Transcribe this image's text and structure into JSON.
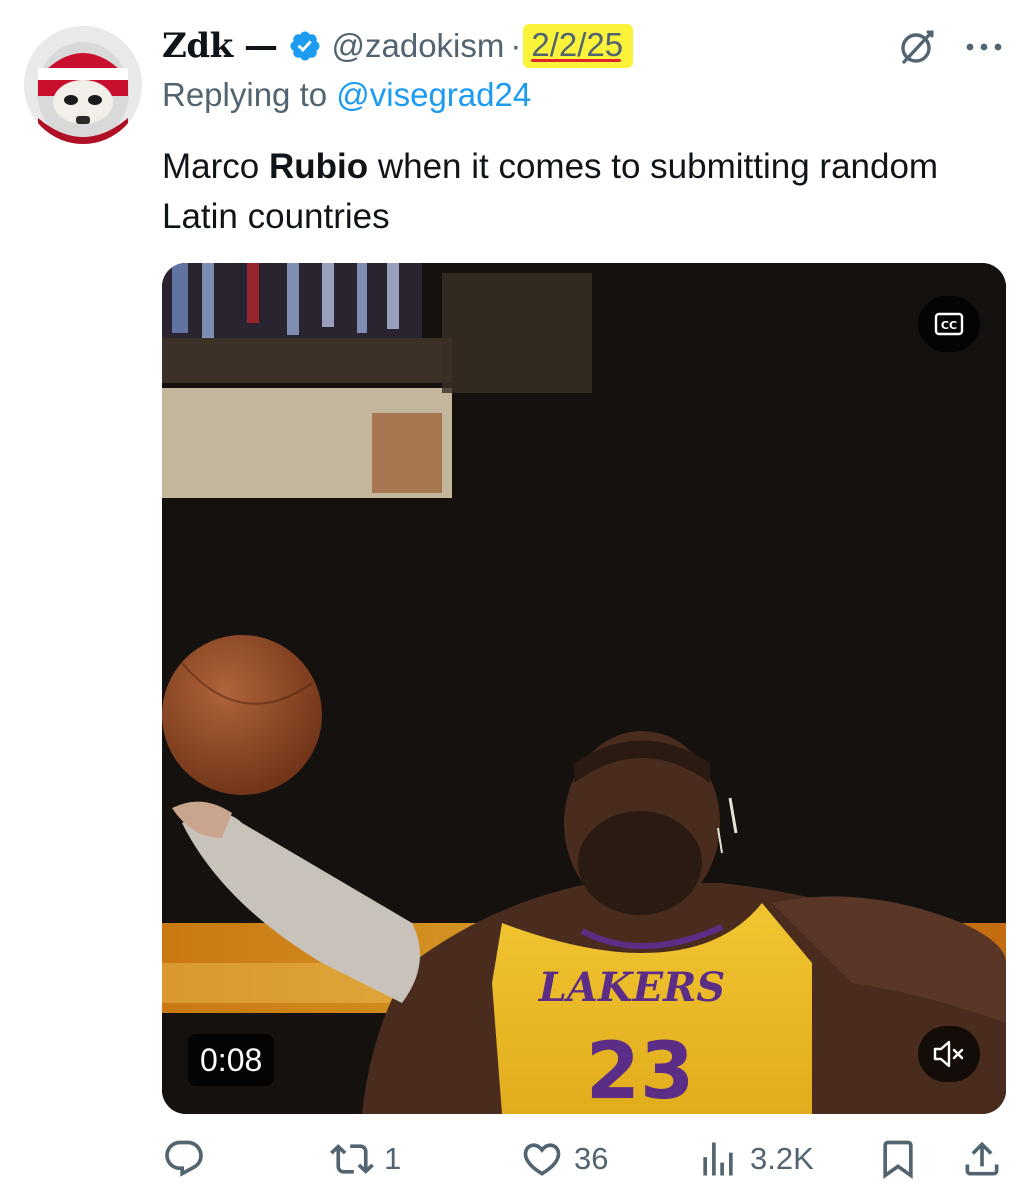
{
  "tweet": {
    "display_name": "Zdk —",
    "handle": "@zadokism",
    "separator": "·",
    "date": "2/2/25",
    "replying_prefix": "Replying to ",
    "replying_to": "@visegrad24",
    "text_before": "Marco ",
    "text_bold": "Rubio",
    "text_after": " when it comes to submitting random Latin countries"
  },
  "media": {
    "duration": "0:08",
    "cc_label": "CC",
    "jersey_text": "LAKERS",
    "jersey_number": "23"
  },
  "actions": {
    "replies": "",
    "reposts": "1",
    "likes": "36",
    "views": "3.2K"
  },
  "icons": {
    "verified": "verified-badge-icon",
    "grok": "grok-icon",
    "more": "more-icon",
    "reply": "reply-icon",
    "repost": "repost-icon",
    "like": "heart-icon",
    "views": "views-icon",
    "bookmark": "bookmark-icon",
    "share": "share-icon"
  },
  "colors": {
    "accent": "#1d9bf0",
    "secondary_text": "#536471",
    "highlight": "#fbf23a",
    "underline": "#e0232a"
  }
}
